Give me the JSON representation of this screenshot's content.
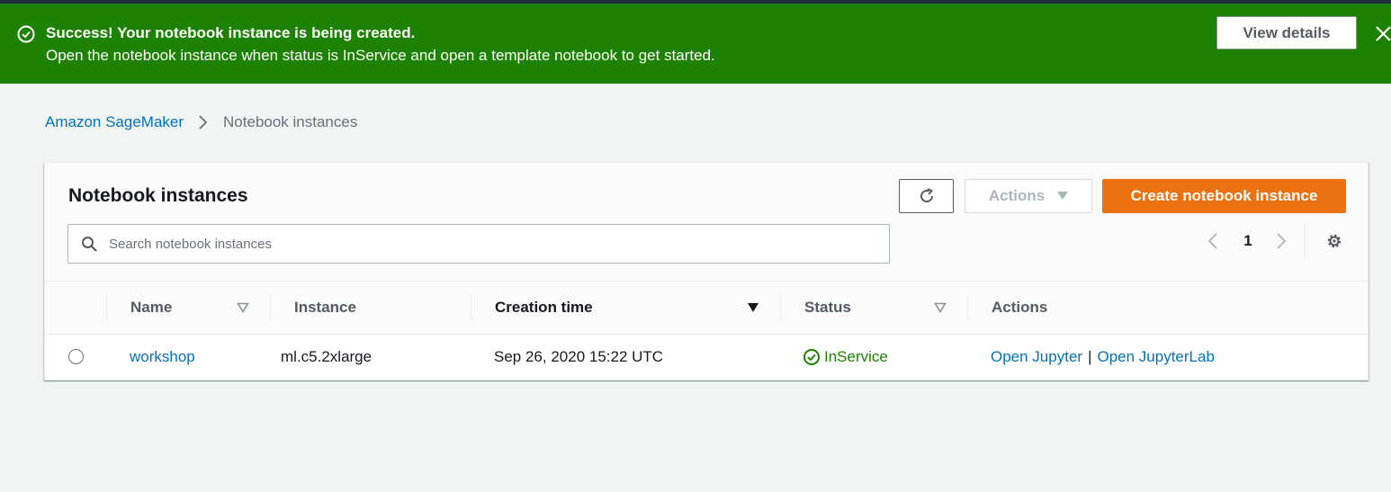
{
  "flash": {
    "title": "Success! Your notebook instance is being created.",
    "message": "Open the notebook instance when status is InService and open a template notebook to get started.",
    "view_details_label": "View details",
    "color": "#1d8102"
  },
  "breadcrumb": {
    "root": "Amazon SageMaker",
    "current": "Notebook instances"
  },
  "panel": {
    "title": "Notebook instances",
    "actions_label": "Actions",
    "create_label": "Create notebook instance",
    "search_placeholder": "Search notebook instances",
    "search_value": "",
    "current_page": "1"
  },
  "table": {
    "columns": [
      "Name",
      "Instance",
      "Creation time",
      "Status",
      "Actions"
    ],
    "rows": [
      {
        "name": "workshop",
        "instance": "ml.c5.2xlarge",
        "creation_time": "Sep 26, 2020 15:22 UTC",
        "status": "InService",
        "action_jupyter": "Open Jupyter",
        "action_separator": "|",
        "action_jupyterlab": "Open JupyterLab"
      }
    ]
  },
  "icons": [
    "success-check-icon",
    "close-icon",
    "chevron-right-icon",
    "refresh-icon",
    "caret-down-icon",
    "search-icon",
    "chevron-left-icon",
    "settings-gear-icon",
    "sort-icon",
    "status-ok-icon"
  ],
  "colors": {
    "accent": "#ec7211",
    "link": "#0073bb",
    "success": "#1d8102"
  }
}
